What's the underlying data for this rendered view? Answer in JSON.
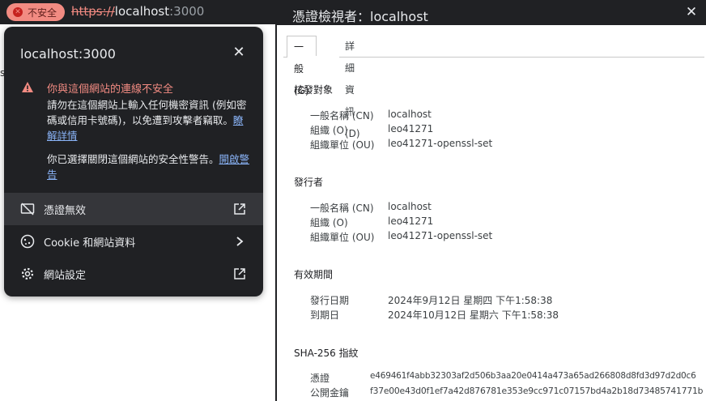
{
  "browser": {
    "insecure_chip": "不安全",
    "url_scheme": "https://",
    "url_host": "localhost",
    "url_port": ":3000",
    "stray_text": "s"
  },
  "site_info": {
    "host": "localhost:3000",
    "close_icon": "close-icon",
    "warning_title": "你與這個網站的連線不安全",
    "warning_body": "請勿在這個網站上輸入任何機密資訊 (例如密碼或信用卡號碼)，以免遭到攻擊者竊取。",
    "learn_more_link": "瞭解詳情",
    "bypass_text": "你已選擇關閉這個網站的安全性警告。",
    "enable_warning_link": "開啟警告",
    "menu": [
      {
        "label": "憑證無效",
        "icon": "certificate-off-icon",
        "trail_icon": "external-link-icon"
      },
      {
        "label": "Cookie 和網站資料",
        "icon": "cookie-icon",
        "trail_icon": "chevron-right-icon"
      },
      {
        "label": "網站設定",
        "icon": "gear-icon",
        "trail_icon": "external-link-icon"
      }
    ],
    "colors": {
      "popup_bg": "#202124",
      "warning": "#f28b82",
      "link": "#8ab4f8"
    }
  },
  "cert_viewer": {
    "title": "憑證檢視者：localhost",
    "tabs": [
      "一般(G)",
      "詳細資訊(D)"
    ],
    "issued_to": {
      "heading": "核發對象",
      "rows": [
        {
          "label": "一般名稱 (CN)",
          "value": "localhost"
        },
        {
          "label": "組織 (O)",
          "value": "leo41271"
        },
        {
          "label": "組織單位 (OU)",
          "value": "leo41271-openssl-set"
        }
      ]
    },
    "issued_by": {
      "heading": "發行者",
      "rows": [
        {
          "label": "一般名稱 (CN)",
          "value": "localhost"
        },
        {
          "label": "組織 (O)",
          "value": "leo41271"
        },
        {
          "label": "組織單位 (OU)",
          "value": "leo41271-openssl-set"
        }
      ]
    },
    "validity": {
      "heading": "有效期間",
      "rows": [
        {
          "label": "發行日期",
          "value": "2024年9月12日 星期四 下午1:58:38"
        },
        {
          "label": "到期日",
          "value": "2024年10月12日 星期六 下午1:58:38"
        }
      ]
    },
    "fingerprints": {
      "heading": "SHA-256 指紋",
      "rows": [
        {
          "label": "憑證",
          "value": "e469461f4abb32303af2d506b3aa20e0414a473a65ad266808d8fd3d97d2d0c6"
        },
        {
          "label": "公開金鑰",
          "value": "f37e00e43d0f1ef7a42d876781e353e9cc971c07157bd4a2b18d73485741771b"
        }
      ]
    }
  }
}
